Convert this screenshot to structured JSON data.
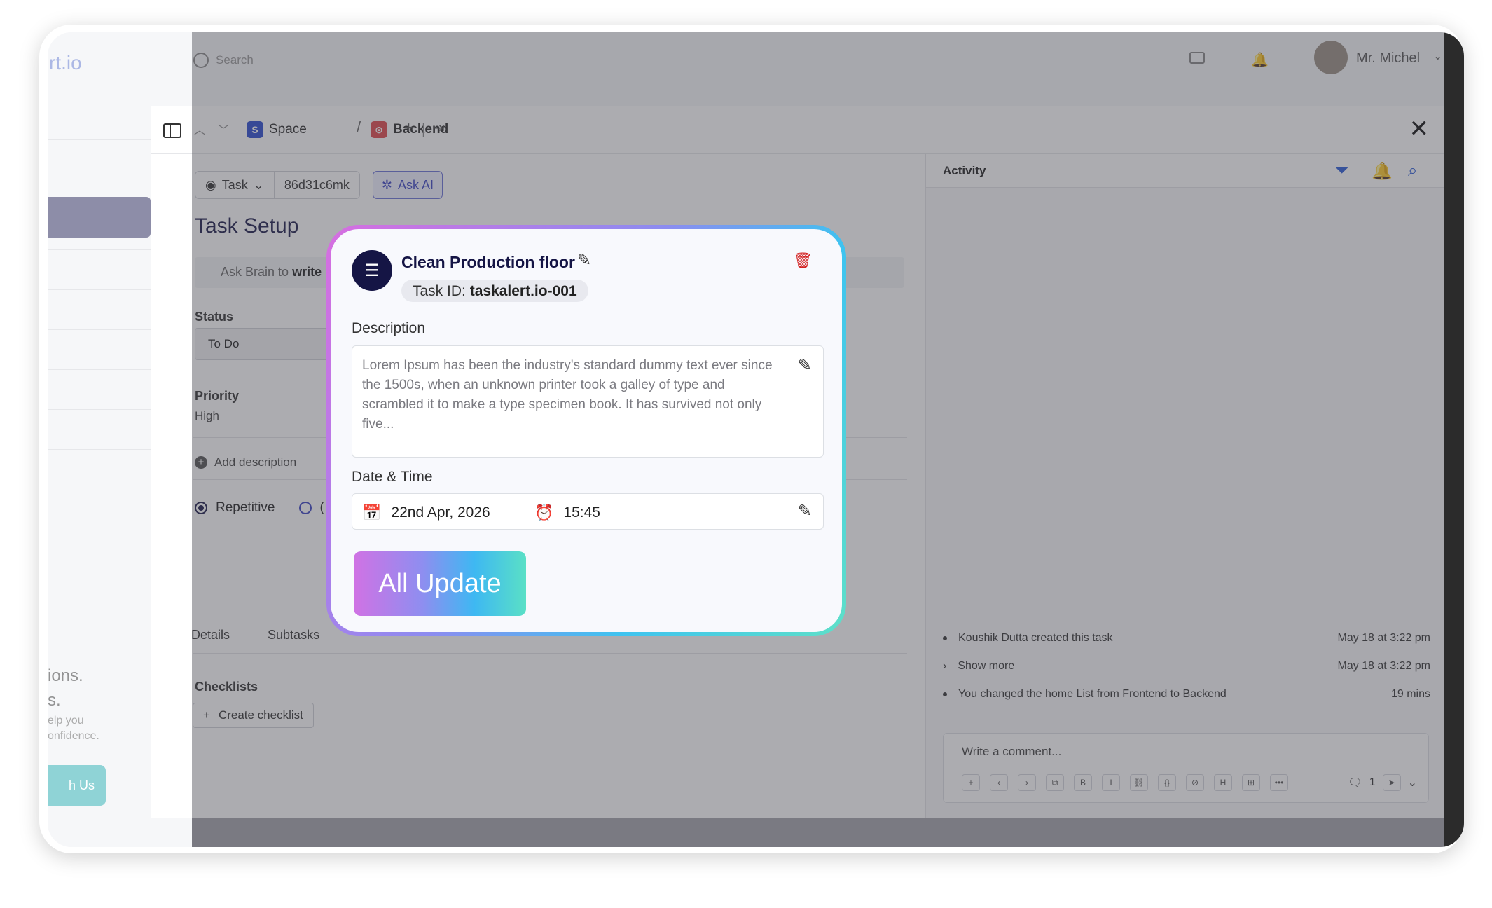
{
  "app": {
    "logo_partial": "rt.io",
    "search_placeholder": "Search",
    "user_name": "Mr. Michel"
  },
  "promo": {
    "title_partial": "ions.",
    "subtitle_partial": "s.",
    "text_line1": "elp you",
    "text_line2": "onfidence.",
    "button_partial": "h Us"
  },
  "header": {
    "breadcrumb": [
      {
        "badge": "S",
        "label": "Space",
        "color": "#2b4bd0"
      },
      {
        "badge": "⊙",
        "label": "Backend",
        "color": "#e0474c"
      }
    ],
    "separator": "/",
    "plus": "+",
    "close": "✕"
  },
  "task": {
    "type_label": "Task",
    "id": "86d31c6mk",
    "ask_ai": "Ask AI",
    "title": "Task Setup",
    "ask_brain_prefix": "Ask Brain to",
    "ask_brain_bold": "write",
    "status_label": "Status",
    "status_value": "To Do",
    "priority_label": "Priority",
    "priority_value": "High",
    "add_description": "Add description",
    "radio_repetitive": "Repetitive",
    "radio_other_partial": "(",
    "tabs": [
      "Details",
      "Subtasks"
    ],
    "checklists_label": "Checklists",
    "create_checklist": "Create checklist"
  },
  "activity": {
    "title": "Activity",
    "items": [
      {
        "text": "Koushik Dutta created this task",
        "time": "May 18 at 3:22 pm",
        "marker": "dot"
      },
      {
        "text": "Show more",
        "time": "May 18 at 3:22 pm",
        "marker": "chevron"
      },
      {
        "text": "You changed the home List from Frontend to Backend",
        "time": "19 mins",
        "marker": "dot"
      }
    ],
    "comment_placeholder": "Write a comment...",
    "comment_count": "1",
    "toolbar": [
      "+",
      "‹",
      "›",
      "⧉",
      "B",
      "I",
      "⛓",
      "{}",
      "⊘",
      "H",
      "⊞",
      "•••"
    ]
  },
  "modal": {
    "title": "Clean Production floor",
    "task_id_label": "Task ID:",
    "task_id_value": "taskalert.io-001",
    "description_label": "Description",
    "description_text": "Lorem Ipsum has been the industry's standard dummy text ever since the 1500s, when an unknown printer took a galley of type and scrambled it to make a type specimen book. It has survived not only five...",
    "datetime_label": "Date & Time",
    "date": "22nd Apr, 2026",
    "time": "15:45",
    "button": "All Update"
  },
  "colors": {
    "accent": "#3b44c4",
    "danger": "#d32222",
    "navy": "#151545",
    "activity_icon": "#2b5bd7"
  }
}
